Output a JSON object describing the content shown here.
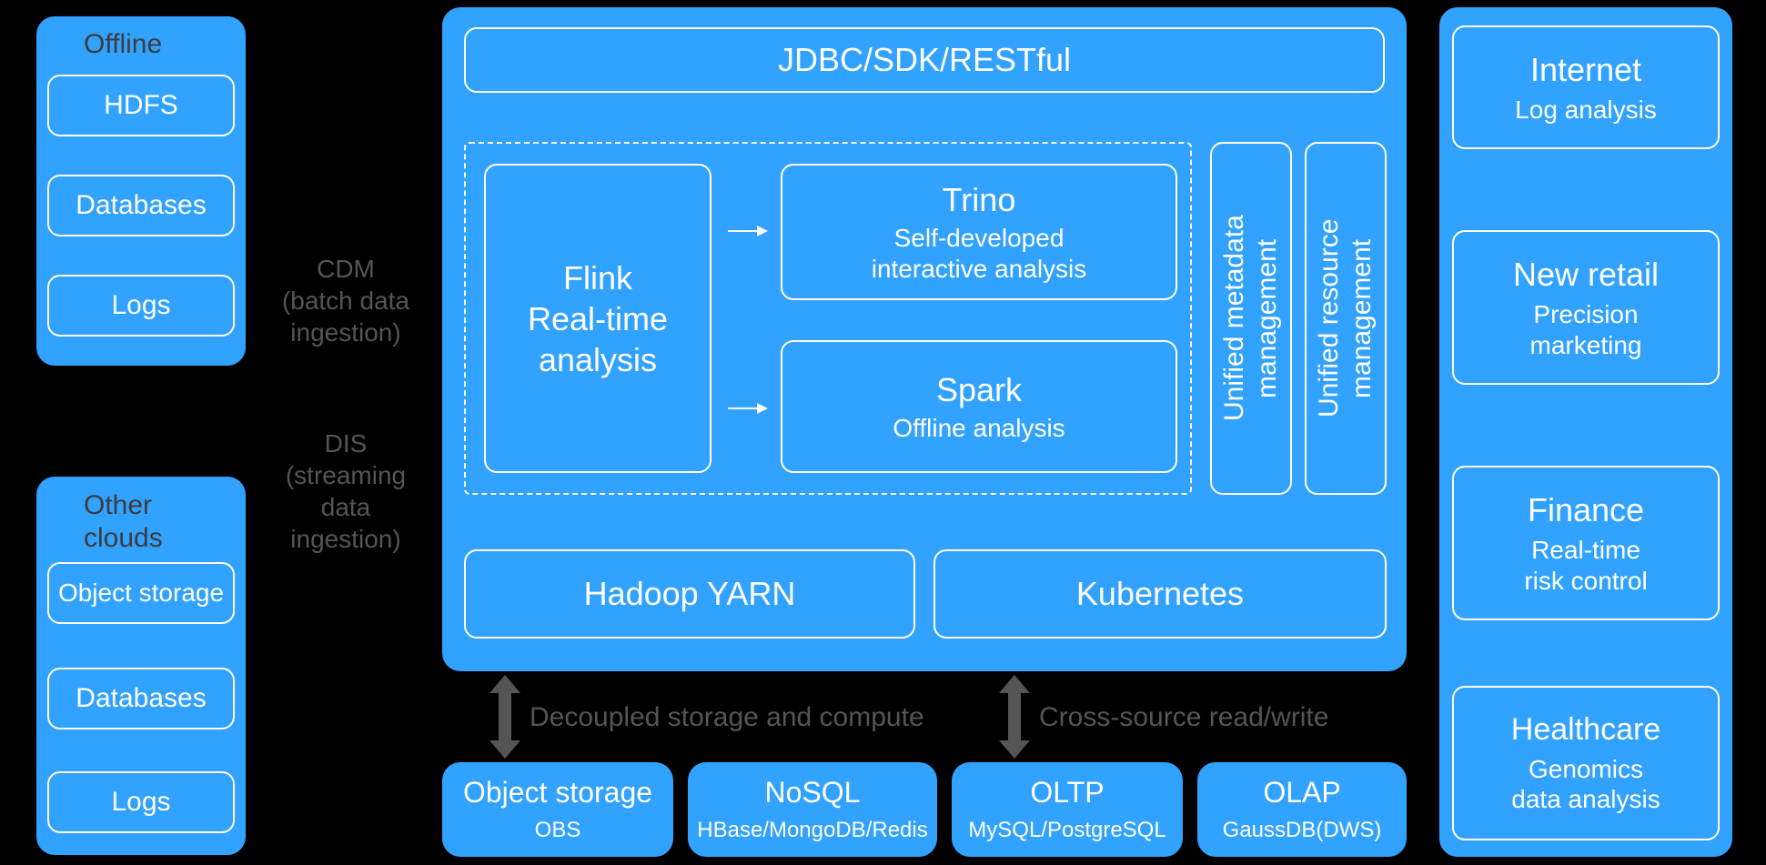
{
  "left": {
    "offline": {
      "title": "Offline",
      "items": [
        "HDFS",
        "Databases",
        "Logs"
      ]
    },
    "other": {
      "title": "Other clouds",
      "items": [
        "Object storage",
        "Databases",
        "Logs"
      ]
    }
  },
  "ingestion": {
    "cdm": "CDM\n(batch data\ningestion)",
    "dis": "DIS\n(streaming\ndata\ningestion)"
  },
  "center": {
    "api": "JDBC/SDK/RESTful",
    "flink": "Flink\nReal-time\nanalysis",
    "trino": {
      "title": "Trino",
      "sub": "Self-developed\ninteractive analysis"
    },
    "spark": {
      "title": "Spark",
      "sub": "Offline analysis"
    },
    "meta": "Unified metadata\nmanagement",
    "resource": "Unified resource\nmanagement",
    "yarn": "Hadoop YARN",
    "k8s": "Kubernetes"
  },
  "connectors": {
    "left": "Decoupled storage and compute",
    "right": "Cross-source read/write"
  },
  "storage": [
    {
      "title": "Object storage",
      "sub": "OBS"
    },
    {
      "title": "NoSQL",
      "sub": "HBase/MongoDB/Redis"
    },
    {
      "title": "OLTP",
      "sub": "MySQL/PostgreSQL"
    },
    {
      "title": "OLAP",
      "sub": "GaussDB(DWS)"
    }
  ],
  "right": [
    {
      "title": "Internet",
      "sub": "Log analysis"
    },
    {
      "title": "New retail",
      "sub": "Precision\nmarketing"
    },
    {
      "title": "Finance",
      "sub": "Real-time\nrisk control"
    },
    {
      "title": "Healthcare",
      "sub": "Genomics\ndata analysis"
    }
  ]
}
